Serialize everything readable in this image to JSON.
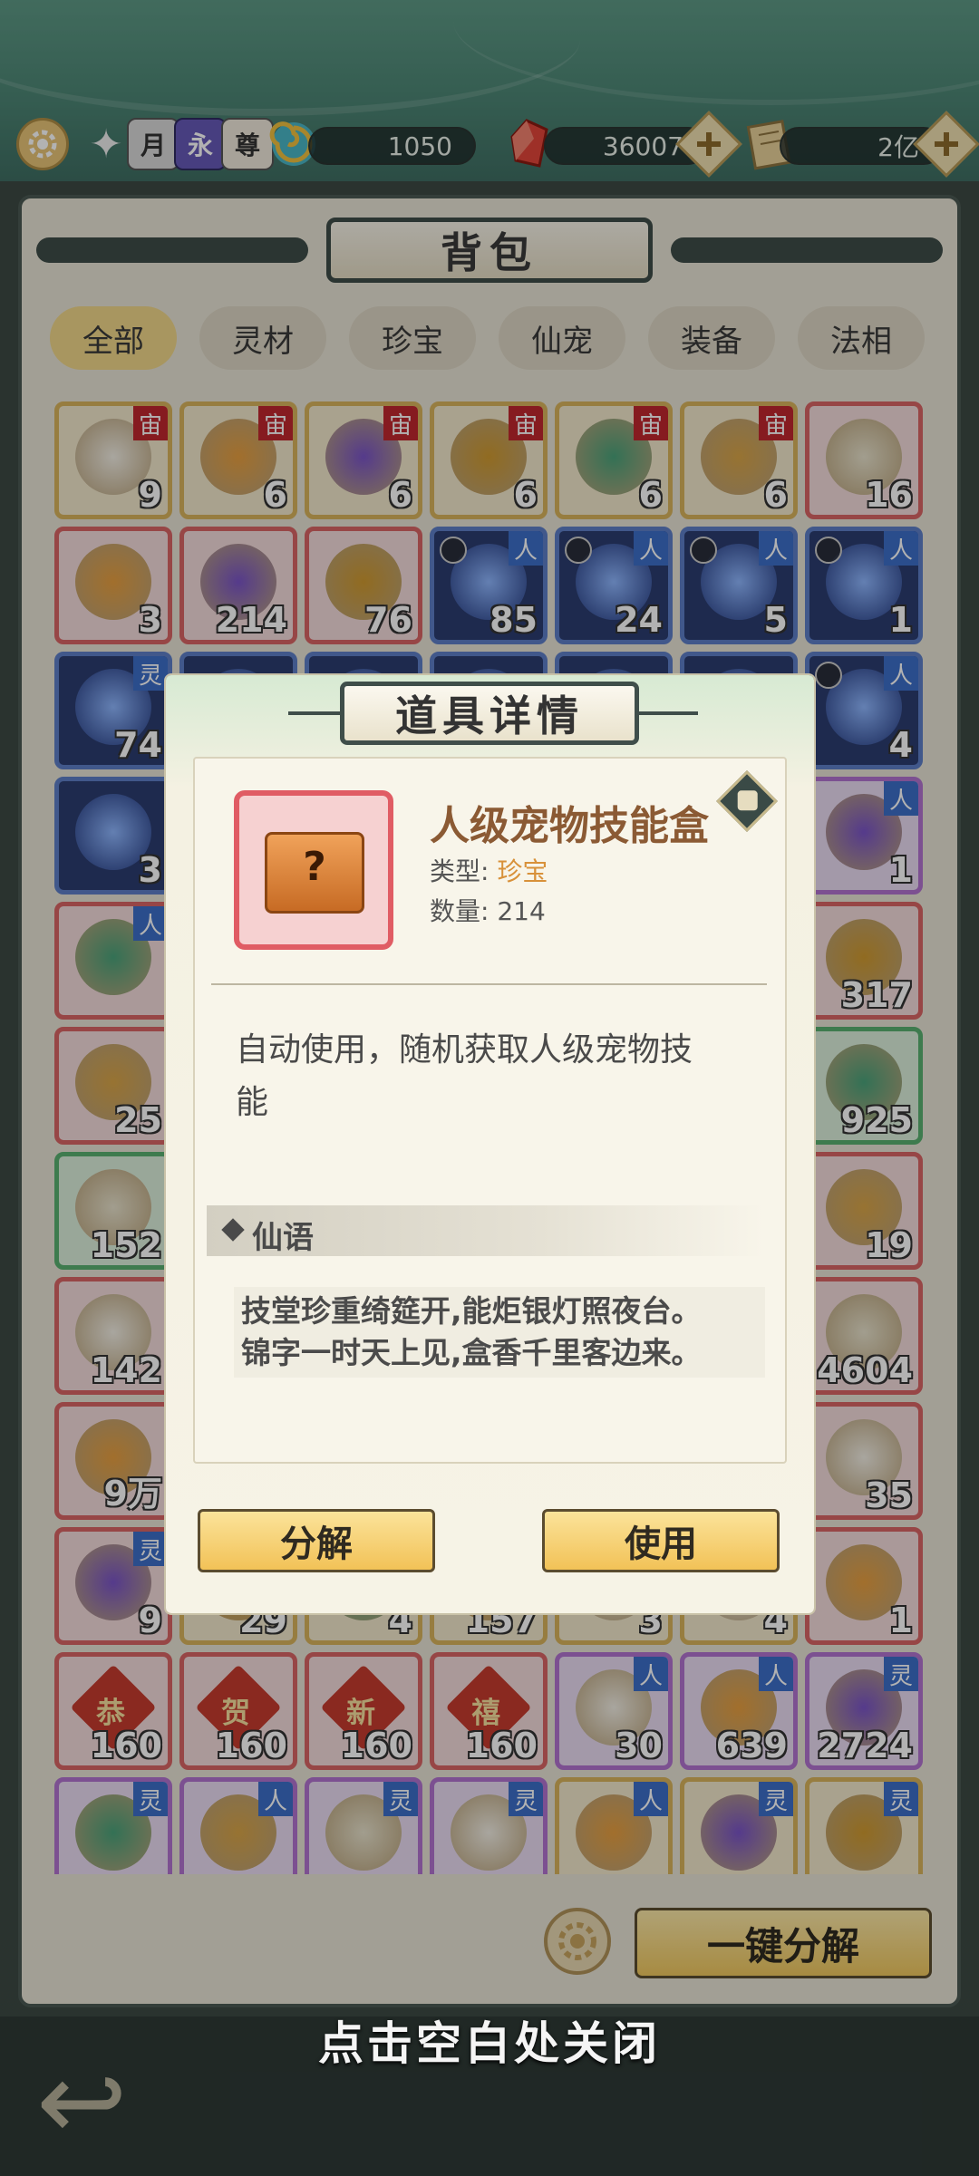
{
  "topbar": {
    "resource_icons": [
      "settings-icon",
      "emblem-icon",
      "moon-token-icon",
      "yong-token-icon",
      "zun-token-icon",
      "spiral-jade-icon"
    ],
    "token_labels": {
      "moon": "月",
      "yong": "永",
      "zun": "尊"
    },
    "jade_value": "1050",
    "crystal_value": "36007",
    "scroll_value": "2亿"
  },
  "bag": {
    "title": "背包",
    "tabs": [
      "全部",
      "灵材",
      "珍宝",
      "仙宠",
      "装备",
      "法相"
    ],
    "active_tab": "全部",
    "decompose_all_label": "一键分解"
  },
  "grid": {
    "rows": [
      [
        {
          "count": "9",
          "tag": "宙",
          "frame": "gold"
        },
        {
          "count": "6",
          "tag": "宙",
          "frame": "gold"
        },
        {
          "count": "6",
          "tag": "宙",
          "frame": "gold"
        },
        {
          "count": "6",
          "tag": "宙",
          "frame": "gold"
        },
        {
          "count": "6",
          "tag": "宙",
          "frame": "gold"
        },
        {
          "count": "6",
          "tag": "宙",
          "frame": "gold"
        },
        {
          "count": "16",
          "tag": "",
          "frame": "red"
        }
      ],
      [
        {
          "count": "3",
          "tag": "",
          "frame": "red"
        },
        {
          "count": "214",
          "tag": "",
          "frame": "red"
        },
        {
          "count": "76",
          "tag": "",
          "frame": "red"
        },
        {
          "count": "85",
          "tag": "人",
          "frame": "blue"
        },
        {
          "count": "24",
          "tag": "人",
          "frame": "blue"
        },
        {
          "count": "5",
          "tag": "人",
          "frame": "blue"
        },
        {
          "count": "1",
          "tag": "人",
          "frame": "blue"
        }
      ],
      [
        {
          "count": "74",
          "tag": "灵",
          "frame": "blue"
        },
        {
          "count": "",
          "tag": "",
          "frame": "blue"
        },
        {
          "count": "",
          "tag": "",
          "frame": "blue"
        },
        {
          "count": "",
          "tag": "",
          "frame": "blue"
        },
        {
          "count": "",
          "tag": "",
          "frame": "blue"
        },
        {
          "count": "",
          "tag": "",
          "frame": "blue"
        },
        {
          "count": "4",
          "tag": "人",
          "frame": "blue"
        }
      ],
      [
        {
          "count": "3",
          "tag": "",
          "frame": "blue"
        },
        {
          "count": "",
          "tag": "",
          "frame": "gold"
        },
        {
          "count": "",
          "tag": "",
          "frame": "gold"
        },
        {
          "count": "",
          "tag": "",
          "frame": "gold"
        },
        {
          "count": "",
          "tag": "",
          "frame": "gold"
        },
        {
          "count": "",
          "tag": "",
          "frame": "gold"
        },
        {
          "count": "1",
          "tag": "人",
          "frame": "purple"
        }
      ],
      [
        {
          "count": "",
          "tag": "人",
          "frame": "red"
        },
        {
          "count": "",
          "tag": "",
          "frame": "gold"
        },
        {
          "count": "",
          "tag": "",
          "frame": "gold"
        },
        {
          "count": "",
          "tag": "",
          "frame": "gold"
        },
        {
          "count": "",
          "tag": "",
          "frame": "gold"
        },
        {
          "count": "",
          "tag": "",
          "frame": "gold"
        },
        {
          "count": "317",
          "tag": "",
          "frame": "red"
        }
      ],
      [
        {
          "count": "25",
          "tag": "",
          "frame": "red"
        },
        {
          "count": "",
          "tag": "",
          "frame": "gold"
        },
        {
          "count": "",
          "tag": "",
          "frame": "gold"
        },
        {
          "count": "",
          "tag": "",
          "frame": "gold"
        },
        {
          "count": "",
          "tag": "",
          "frame": "gold"
        },
        {
          "count": "",
          "tag": "",
          "frame": "gold"
        },
        {
          "count": "925",
          "tag": "",
          "frame": "green"
        }
      ],
      [
        {
          "count": "152",
          "tag": "",
          "frame": "green"
        },
        {
          "count": "",
          "tag": "",
          "frame": "gold"
        },
        {
          "count": "",
          "tag": "",
          "frame": "gold"
        },
        {
          "count": "",
          "tag": "",
          "frame": "gold"
        },
        {
          "count": "",
          "tag": "",
          "frame": "gold"
        },
        {
          "count": "",
          "tag": "",
          "frame": "gold"
        },
        {
          "count": "19",
          "tag": "",
          "frame": "red"
        }
      ],
      [
        {
          "count": "142",
          "tag": "",
          "frame": "red"
        },
        {
          "count": "",
          "tag": "",
          "frame": "gold"
        },
        {
          "count": "",
          "tag": "",
          "frame": "gold"
        },
        {
          "count": "",
          "tag": "",
          "frame": "gold"
        },
        {
          "count": "",
          "tag": "",
          "frame": "gold"
        },
        {
          "count": "",
          "tag": "",
          "frame": "gold"
        },
        {
          "count": "4604",
          "tag": "",
          "frame": "red"
        }
      ],
      [
        {
          "count": "9万",
          "tag": "",
          "frame": "red"
        },
        {
          "count": "",
          "tag": "",
          "frame": "gold"
        },
        {
          "count": "",
          "tag": "",
          "frame": "gold"
        },
        {
          "count": "",
          "tag": "",
          "frame": "gold"
        },
        {
          "count": "",
          "tag": "",
          "frame": "gold"
        },
        {
          "count": "",
          "tag": "",
          "frame": "gold"
        },
        {
          "count": "35",
          "tag": "",
          "frame": "red"
        }
      ],
      [
        {
          "count": "9",
          "tag": "灵",
          "frame": "red"
        },
        {
          "count": "29",
          "tag": "",
          "frame": "gold"
        },
        {
          "count": "4",
          "tag": "",
          "frame": "gold"
        },
        {
          "count": "157",
          "tag": "",
          "frame": "gold"
        },
        {
          "count": "3",
          "tag": "",
          "frame": "gold"
        },
        {
          "count": "4",
          "tag": "",
          "frame": "gold"
        },
        {
          "count": "1",
          "tag": "",
          "frame": "red"
        }
      ],
      [
        {
          "count": "160",
          "tag": "",
          "frame": "red",
          "glyph": "恭"
        },
        {
          "count": "160",
          "tag": "",
          "frame": "red",
          "glyph": "贺"
        },
        {
          "count": "160",
          "tag": "",
          "frame": "red",
          "glyph": "新"
        },
        {
          "count": "160",
          "tag": "",
          "frame": "red",
          "glyph": "禧"
        },
        {
          "count": "30",
          "tag": "人",
          "frame": "purple"
        },
        {
          "count": "639",
          "tag": "人",
          "frame": "purple"
        },
        {
          "count": "2724",
          "tag": "灵",
          "frame": "purple"
        }
      ],
      [
        {
          "count": "",
          "tag": "灵",
          "frame": "purple"
        },
        {
          "count": "",
          "tag": "人",
          "frame": "purple"
        },
        {
          "count": "",
          "tag": "灵",
          "frame": "purple"
        },
        {
          "count": "",
          "tag": "灵",
          "frame": "purple"
        },
        {
          "count": "",
          "tag": "人",
          "frame": "gold"
        },
        {
          "count": "",
          "tag": "灵",
          "frame": "gold"
        },
        {
          "count": "",
          "tag": "灵",
          "frame": "gold"
        }
      ]
    ]
  },
  "modal": {
    "title": "道具详情",
    "item_name": "人级宠物技能盒",
    "type_label": "类型:",
    "type_value": "珍宝",
    "count_label": "数量:",
    "count_value": "214",
    "description": "自动使用，随机获取人级宠物技能",
    "xianyu_label": "仙语",
    "poem_line1": "技堂珍重绮筵开,能炬银灯照夜台。",
    "poem_line2": "锦字一时天上见,盒香千里客边来。",
    "decompose_label": "分解",
    "use_label": "使用",
    "item_box_glyph": "?"
  },
  "close_hint": "点击空白处关闭",
  "colors": {
    "accent_gold": "#f2c257",
    "name_brown": "#8b5a34",
    "type_orange": "#d8913a",
    "tag_red": "#c0282e",
    "tag_blue": "#3d6fc9"
  }
}
